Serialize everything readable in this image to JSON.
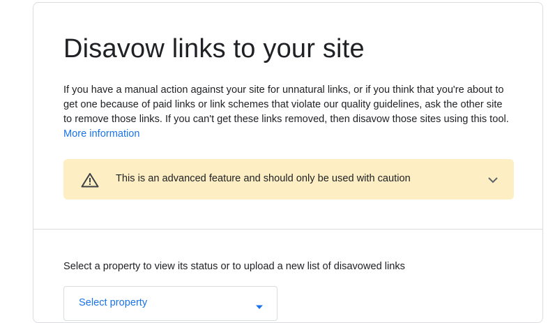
{
  "page": {
    "title": "Disavow links to your site",
    "description": "If you have a manual action against your site for unnatural links, or if you think that you're about to get one because of paid links or link schemes that violate our quality guidelines, ask the other site to remove those links. If you can't get these links removed, then disavow those sites using this tool.",
    "more_info_link": "More information"
  },
  "warning": {
    "icon": "warning-icon",
    "text": "This is an advanced feature and should only be used with caution",
    "expand_icon": "chevron-down-icon"
  },
  "property": {
    "label": "Select a property to view its status or to upload a new list of disavowed links",
    "dropdown_value": "Select property",
    "dropdown_icon": "dropdown-arrow-icon"
  },
  "colors": {
    "accent": "#1a73e8",
    "warning_bg": "#fdefc3",
    "text": "#202124",
    "border": "#dadce0"
  }
}
